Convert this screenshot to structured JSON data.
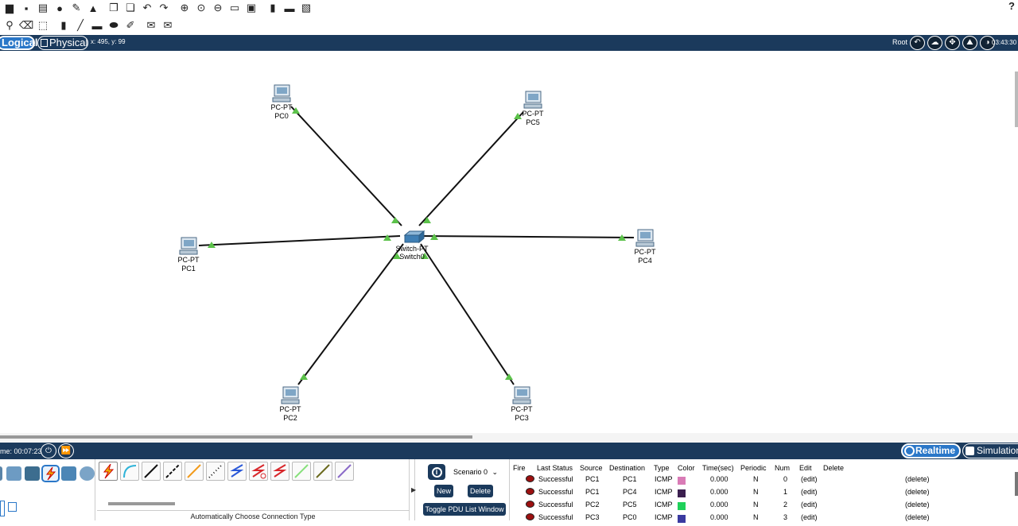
{
  "toolbar": {
    "help": "?"
  },
  "modebar": {
    "logical_label": "Logical",
    "physical_label": "Physical",
    "coords": "x: 495, y: 99",
    "root_label": "Root",
    "clock": "03:43:30"
  },
  "devices": {
    "pc0": {
      "type": "PC-PT",
      "name": "PC0"
    },
    "pc1": {
      "type": "PC-PT",
      "name": "PC1"
    },
    "pc2": {
      "type": "PC-PT",
      "name": "PC2"
    },
    "pc3": {
      "type": "PC-PT",
      "name": "PC3"
    },
    "pc4": {
      "type": "PC-PT",
      "name": "PC4"
    },
    "pc5": {
      "type": "PC-PT",
      "name": "PC5"
    },
    "switch0": {
      "type": "Switch-PT",
      "name": "Switch0"
    }
  },
  "statusbar": {
    "time": "me: 00:07:23",
    "realtime_label": "Realtime",
    "simulation_label": "Simulation"
  },
  "connections": {
    "label": "Automatically Choose Connection Type"
  },
  "pdu": {
    "scenario": "Scenario 0",
    "new_label": "New",
    "delete_label": "Delete",
    "toggle_label": "Toggle PDU List Window"
  },
  "events": {
    "headers": {
      "fire": "Fire",
      "last_status": "Last Status",
      "source": "Source",
      "destination": "Destination",
      "type": "Type",
      "color": "Color",
      "time": "Time(sec)",
      "periodic": "Periodic",
      "num": "Num",
      "edit": "Edit",
      "delete": "Delete"
    },
    "rows": [
      {
        "status": "Successful",
        "source": "PC1",
        "destination": "PC1",
        "type": "ICMP",
        "color": "#d97bb6",
        "time": "0.000",
        "periodic": "N",
        "num": "0",
        "edit": "(edit)",
        "delete": "(delete)"
      },
      {
        "status": "Successful",
        "source": "PC1",
        "destination": "PC4",
        "type": "ICMP",
        "color": "#3b1f4f",
        "time": "0.000",
        "periodic": "N",
        "num": "1",
        "edit": "(edit)",
        "delete": "(delete)"
      },
      {
        "status": "Successful",
        "source": "PC2",
        "destination": "PC5",
        "type": "ICMP",
        "color": "#1fd15a",
        "time": "0.000",
        "periodic": "N",
        "num": "2",
        "edit": "(edit)",
        "delete": "(delete)"
      },
      {
        "status": "Successful",
        "source": "PC3",
        "destination": "PC0",
        "type": "ICMP",
        "color": "#3a3aa0",
        "time": "0.000",
        "periodic": "N",
        "num": "3",
        "edit": "(edit)",
        "delete": "(delete)"
      }
    ]
  },
  "colors": {
    "bar": "#1b3a5c",
    "accent": "#2a77c8",
    "link_up": "#5cc24a"
  }
}
